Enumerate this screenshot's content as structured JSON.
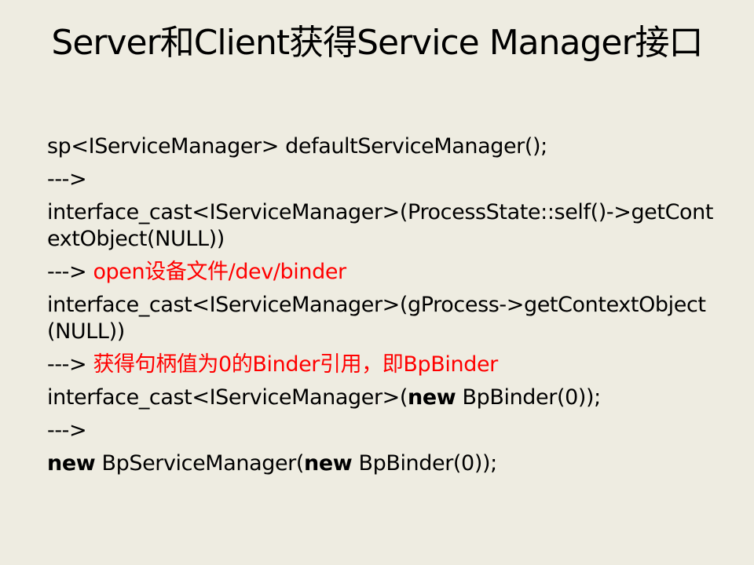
{
  "title": "Server和Client获得Service Manager接口",
  "accent_color": "#ff0000",
  "lines": [
    [
      {
        "text": "sp<IServiceManager> defaultServiceManager();",
        "style": "normal"
      }
    ],
    [
      {
        "text": "--->",
        "style": "normal"
      }
    ],
    [
      {
        "text": "interface_cast<IServiceManager>(ProcessState::self()->getContextObject(NULL))",
        "style": "normal"
      }
    ],
    [
      {
        "text": "---> ",
        "style": "normal"
      },
      {
        "text": "open设备文件/dev/binder",
        "style": "red"
      }
    ],
    [
      {
        "text": "interface_cast<IServiceManager>(gProcess->getContextObject(NULL))",
        "style": "normal"
      }
    ],
    [
      {
        "text": "---> ",
        "style": "normal"
      },
      {
        "text": "获得句柄值为0的Binder引用，即BpBinder",
        "style": "red"
      }
    ],
    [
      {
        "text": "interface_cast<IServiceManager>(",
        "style": "normal"
      },
      {
        "text": "new",
        "style": "bold"
      },
      {
        "text": " BpBinder(0));",
        "style": "normal"
      }
    ],
    [
      {
        "text": "--->",
        "style": "normal"
      }
    ],
    [
      {
        "text": "new",
        "style": "bold"
      },
      {
        "text": " BpServiceManager(",
        "style": "normal"
      },
      {
        "text": "new",
        "style": "bold"
      },
      {
        "text": " BpBinder(0));",
        "style": "normal"
      }
    ]
  ]
}
